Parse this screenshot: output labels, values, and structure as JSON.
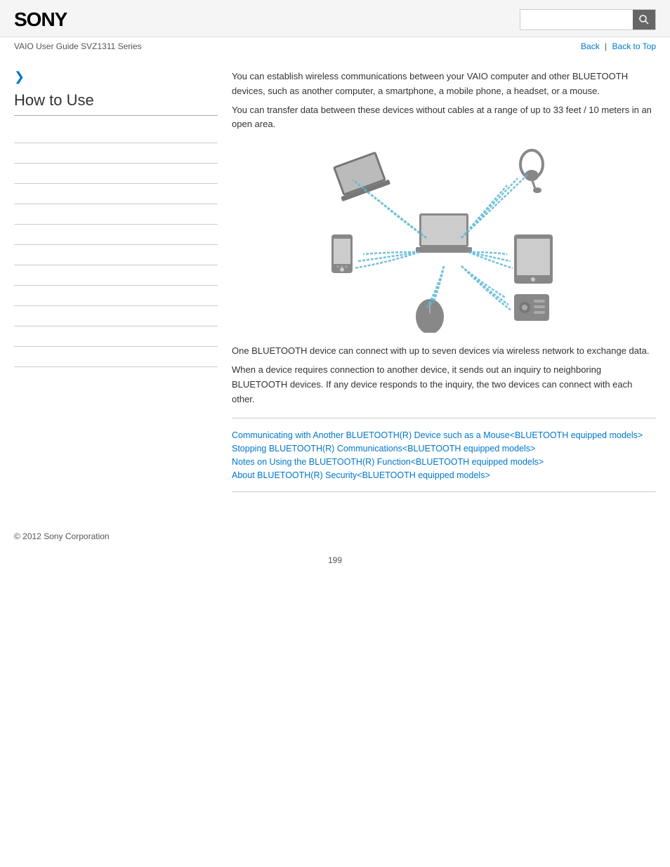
{
  "header": {
    "logo": "SONY",
    "search_placeholder": "",
    "search_icon": "🔍"
  },
  "breadcrumb": {
    "guide_title": "VAIO User Guide SVZ1311 Series",
    "back_label": "Back",
    "back_to_top_label": "Back to Top",
    "separator": "|"
  },
  "sidebar": {
    "arrow": "❯",
    "section_title": "How to Use",
    "links": [
      {
        "label": ""
      },
      {
        "label": ""
      },
      {
        "label": ""
      },
      {
        "label": ""
      },
      {
        "label": ""
      },
      {
        "label": ""
      },
      {
        "label": ""
      },
      {
        "label": ""
      },
      {
        "label": ""
      },
      {
        "label": ""
      },
      {
        "label": ""
      },
      {
        "label": ""
      }
    ]
  },
  "content": {
    "intro_p1": "You can establish wireless communications between your VAIO computer and other BLUETOOTH devices, such as another computer, a smartphone, a mobile phone, a headset, or a mouse.",
    "intro_p2": "You can transfer data between these devices without cables at a range of up to 33 feet / 10 meters in an open area.",
    "body_p1": "One BLUETOOTH device can connect with up to seven devices via wireless network to exchange data.",
    "body_p2": "When a device requires connection to another device, it sends out an inquiry to neighboring BLUETOOTH devices. If any device responds to the inquiry, the two devices can connect with each other.",
    "related_links": [
      {
        "label": "Communicating with Another BLUETOOTH(R) Device such as a Mouse<BLUETOOTH equipped models>"
      },
      {
        "label": "Stopping BLUETOOTH(R) Communications<BLUETOOTH equipped models>"
      },
      {
        "label": "Notes on Using the BLUETOOTH(R) Function<BLUETOOTH equipped models>"
      },
      {
        "label": "About BLUETOOTH(R) Security<BLUETOOTH equipped models>"
      }
    ]
  },
  "footer": {
    "copyright": "© 2012 Sony Corporation"
  },
  "page_number": "199"
}
